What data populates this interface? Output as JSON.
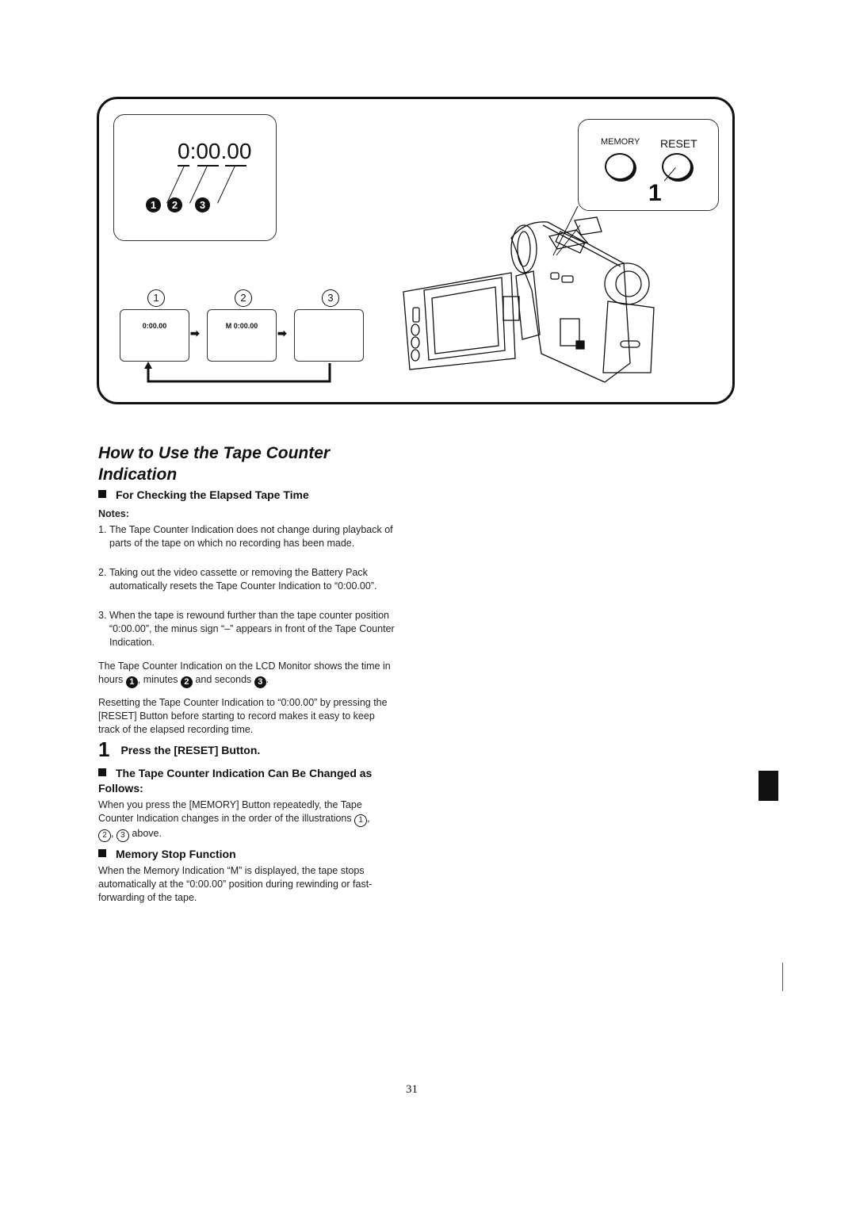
{
  "illustration": {
    "big_counter": {
      "hours": "0",
      "sep1": ":",
      "minutes": "00",
      "sep2": ".",
      "seconds": "00",
      "markers": [
        "1",
        "2",
        "3"
      ]
    },
    "button_panel": {
      "memory_label": "MEMORY",
      "reset_label": "RESET",
      "step_callout": "1"
    },
    "sequence": [
      {
        "number": "1",
        "display": "0:00.00"
      },
      {
        "number": "2",
        "display": "M  0:00.00"
      },
      {
        "number": "3",
        "display": ""
      }
    ],
    "arrow_glyph": "➡"
  },
  "content": {
    "title": "How to Use the Tape Counter Indication",
    "subhead_elapsed": "For Checking the Elapsed Tape Time",
    "notes_label": "Notes:",
    "notes": [
      {
        "n": "1.",
        "text": "The Tape Counter Indication does not change during playback of parts of the tape on which no recording has been made."
      },
      {
        "n": "2.",
        "text": "Taking out the video cassette or removing the Battery Pack automatically resets the Tape Counter Indication to “0:00.00”."
      },
      {
        "n": "3.",
        "text": "When the tape is rewound further than the tape counter position “0:00.00”, the minus sign “–” appears in front of the Tape Counter Indication."
      }
    ],
    "lcd_para": {
      "part1": "The Tape Counter Indication on the LCD Monitor shows the time in hours ",
      "m1": "1",
      "part2": ", minutes ",
      "m2": "2",
      "part3": " and seconds ",
      "m3": "3",
      "part4": "."
    },
    "reset_para": "Resetting the Tape Counter Indication to “0:00.00” by pressing the [RESET] Button before starting to record makes it easy to keep track of the elapsed recording time.",
    "step1": {
      "number": "1",
      "label": "Press the [RESET] Button."
    },
    "subhead_changed": "The Tape Counter Indication Can Be Changed as Follows:",
    "changed_para": {
      "part1": "When you press the [MEMORY] Button repeatedly, the Tape Counter Indication changes in the order of the illustrations ",
      "c1": "1",
      "c2": "2",
      "c3": "3",
      "part2": " above."
    },
    "subhead_memory": "Memory Stop Function",
    "memory_para": "When the Memory Indication “M” is displayed, the tape stops automatically at the “0:00.00” position during rewinding or fast-forwarding of the tape."
  },
  "page_number": "31"
}
